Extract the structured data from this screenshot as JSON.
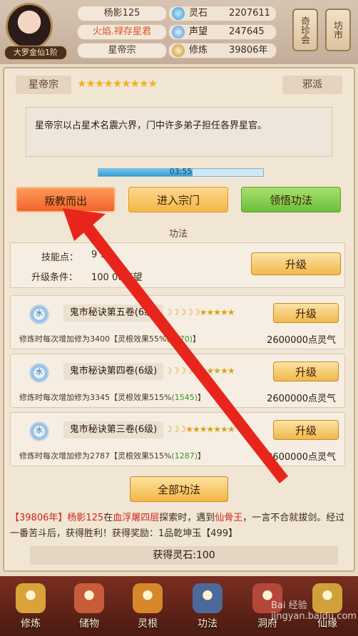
{
  "player": {
    "name": "杨影125",
    "title": "火焰.禄存星君",
    "sect": "星帝宗",
    "rank": "大罗金仙1阶"
  },
  "resources": [
    {
      "icon": "spirit-stone-icon",
      "label": "灵石",
      "value": "2207611"
    },
    {
      "icon": "prestige-icon",
      "label": "声望",
      "value": "247645"
    },
    {
      "icon": "cultivation-icon",
      "label": "修炼",
      "value": "39806年"
    }
  ],
  "side_buttons": {
    "treasure": "奇珍会",
    "market": "坊市"
  },
  "sect_panel": {
    "sect_name": "星帝宗",
    "stars": "★★★★★★★★★",
    "alignment": "邪派",
    "description": "星帝宗以占星术名震六界，门中许多弟子担任各界星官。",
    "timer": "03:55",
    "timer_progress": 0.57,
    "buttons": {
      "betray": "叛教而出",
      "enter": "进入宗门",
      "comprehend": "领悟功法"
    }
  },
  "skills_section": {
    "title": "功法",
    "points_label": "技能点：",
    "points_value": "9  91",
    "condition_label": "升级条件：",
    "condition_value": "100  00声望",
    "upgrade_label": "升级"
  },
  "skills": [
    {
      "badge": "水",
      "name": "鬼市秘诀第五卷(6级)",
      "moons": "☽☽☽☽☽★★★★★",
      "desc_a": "修炼时每次增加修为3400【灵根效果5",
      "desc_b": "5%",
      "desc_green": "(1570)",
      "desc_c": "】",
      "reward": "2600000点灵气",
      "upgrade": "升级"
    },
    {
      "badge": "水",
      "name": "鬼市秘诀第四卷(6级)",
      "moons": "☽☽☽☽★★★★★★",
      "desc_a": "修炼时每次增加修为3345【灵根效果515%",
      "desc_b": "",
      "desc_green": "(1545)",
      "desc_c": "】",
      "reward": "2600000点灵气",
      "upgrade": "升级"
    },
    {
      "badge": "水",
      "name": "鬼市秘诀第三卷(6级)",
      "moons": "☽☽☽★★★★★★★",
      "desc_a": "修炼时每次增加修为2787【灵根效果515%",
      "desc_b": "",
      "desc_green": "(1287)",
      "desc_c": "】",
      "reward": "2600000点灵气",
      "upgrade": "升级"
    }
  ],
  "all_skills_button": "全部功法",
  "log": {
    "year": "【39806年】",
    "player": "杨影125",
    "text1": "在",
    "place": "血浮屠四层",
    "text2": "探索时，遇到",
    "enemy": "仙骨王",
    "text3": "，一言不合就拔剑。经过一番苦斗后，获得胜利！获得奖励：1品乾坤玉【499】"
  },
  "reward_line": "获得灵石:100",
  "bottom_nav": [
    {
      "label": "修炼",
      "icon": "cultivate-icon",
      "color": "#d9a23a"
    },
    {
      "label": "储物",
      "icon": "storage-bag-icon",
      "color": "#c65c3a"
    },
    {
      "label": "灵根",
      "icon": "spirit-root-icon",
      "color": "#d8862a"
    },
    {
      "label": "功法",
      "icon": "skill-book-icon",
      "color": "#4b6a9a"
    },
    {
      "label": "洞府",
      "icon": "cave-house-icon",
      "color": "#b3473a"
    },
    {
      "label": "仙缘",
      "icon": "immortal-fate-icon",
      "color": "#d0a13a"
    }
  ],
  "watermark": "Bai 经验 jingyan.baidu.com",
  "colors": {
    "accent_red": "#d0251b",
    "highlight_green": "#3d8f2b",
    "arrow": "#e8251c"
  }
}
